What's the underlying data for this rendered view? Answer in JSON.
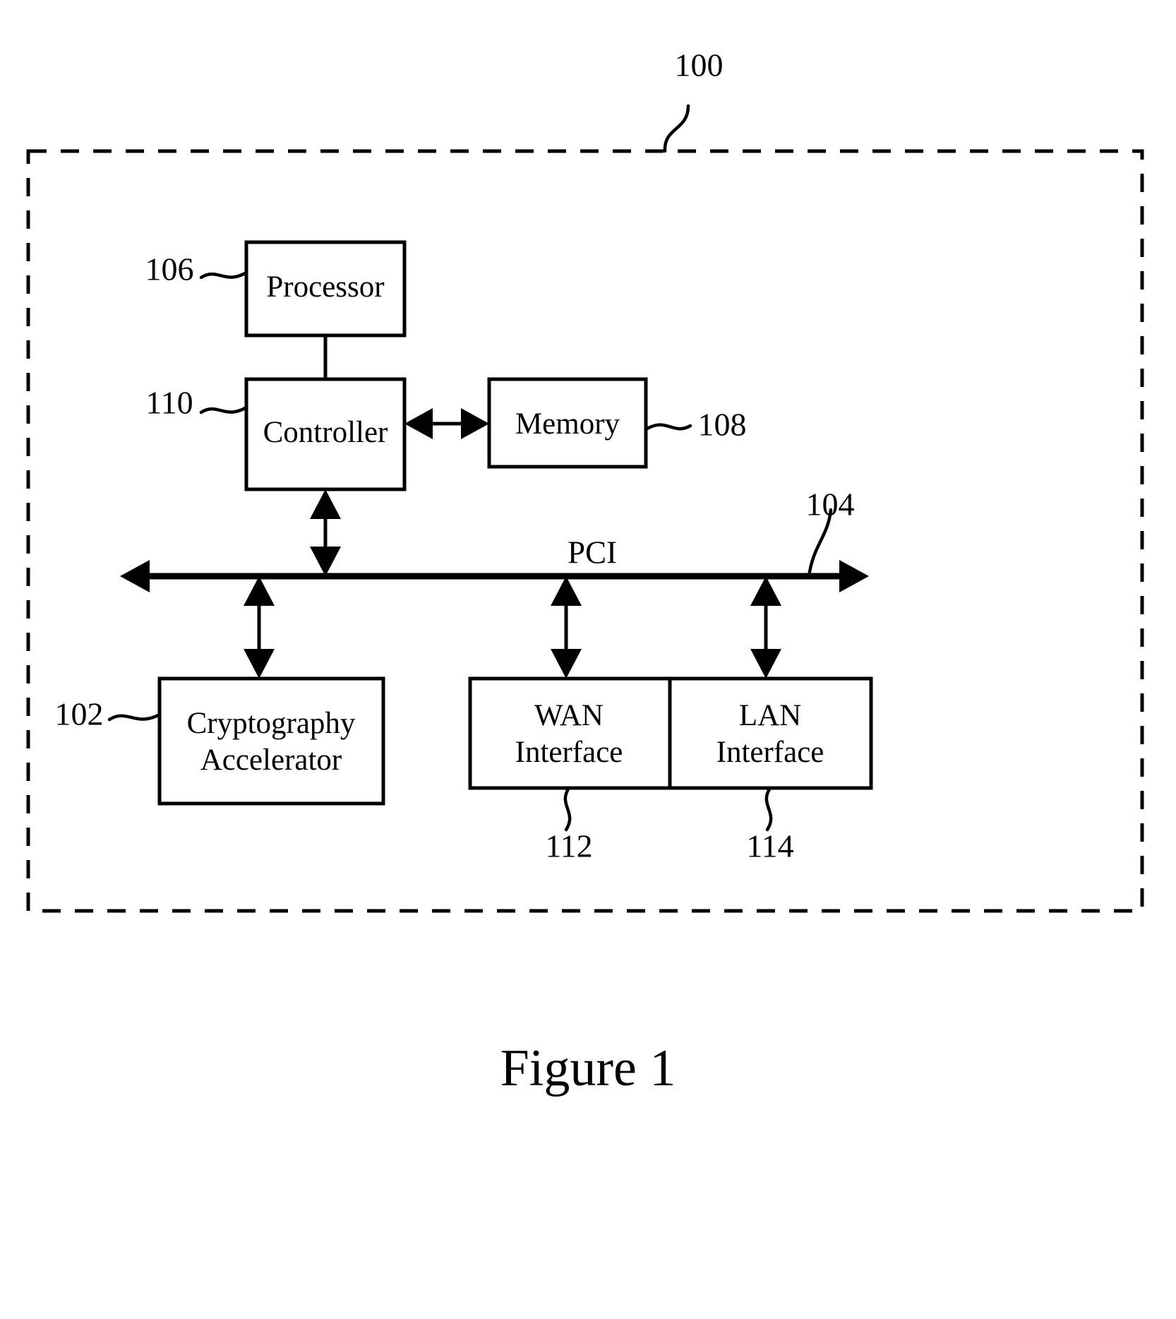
{
  "figure": {
    "caption": "Figure 1",
    "enclosure_ref": "100",
    "bus_label": "PCI",
    "bus_ref": "104"
  },
  "blocks": {
    "processor": {
      "label": "Processor",
      "ref": "106"
    },
    "controller": {
      "label": "Controller",
      "ref": "110"
    },
    "memory": {
      "label": "Memory",
      "ref": "108"
    },
    "crypto": {
      "label_line1": "Cryptography",
      "label_line2": "Accelerator",
      "ref": "102"
    },
    "wan": {
      "label_line1": "WAN",
      "label_line2": "Interface",
      "ref": "112"
    },
    "lan": {
      "label_line1": "LAN",
      "label_line2": "Interface",
      "ref": "114"
    }
  },
  "colors": {
    "ink": "#000000",
    "paper": "#ffffff"
  }
}
